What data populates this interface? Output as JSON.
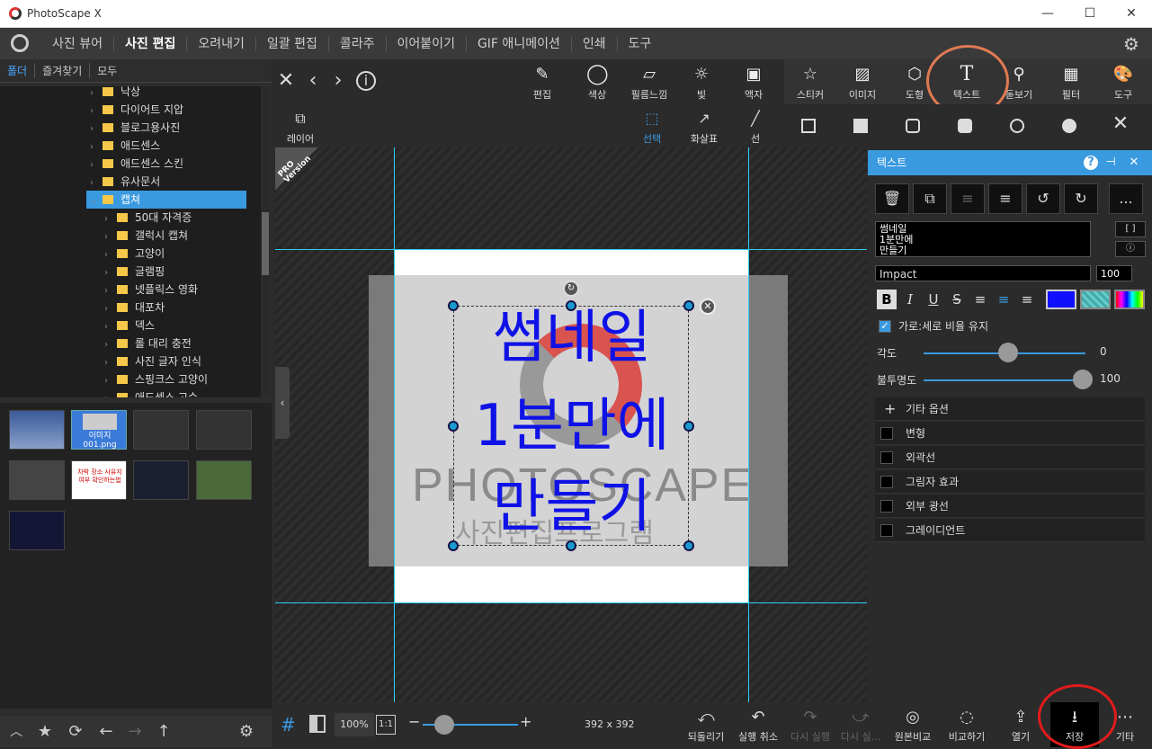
{
  "app": {
    "title": "PhotoScape X",
    "window_controls": [
      "—",
      "☐",
      "✕"
    ]
  },
  "menu": {
    "items": [
      "사진 뷰어",
      "사진 편집",
      "오려내기",
      "일괄 편집",
      "콜라주",
      "이어붙이기",
      "GIF 애니메이션",
      "인쇄",
      "도구"
    ],
    "active": "사진 편집"
  },
  "left_panel": {
    "tabs": [
      "폴더",
      "즐겨찾기",
      "모두"
    ],
    "tree": [
      {
        "label": "낙상",
        "level": 1
      },
      {
        "label": "다이어트 지압",
        "level": 1
      },
      {
        "label": "블로그용사진",
        "level": 1
      },
      {
        "label": "애드센스",
        "level": 1
      },
      {
        "label": "애드센스 스킨",
        "level": 1
      },
      {
        "label": "유사문서",
        "level": 1
      },
      {
        "label": "캡쳐",
        "level": 1,
        "selected": true
      },
      {
        "label": "50대 자격증",
        "level": 2
      },
      {
        "label": "갤럭시 캡쳐",
        "level": 2
      },
      {
        "label": "고양이",
        "level": 2
      },
      {
        "label": "글램핑",
        "level": 2
      },
      {
        "label": "넷플릭스 영화",
        "level": 2
      },
      {
        "label": "대포차",
        "level": 2
      },
      {
        "label": "덱스",
        "level": 2
      },
      {
        "label": "롤 대리 충전",
        "level": 2
      },
      {
        "label": "사진 글자 인식",
        "level": 2
      },
      {
        "label": "스핑크스 고양이",
        "level": 2
      },
      {
        "label": "애드센스 고수",
        "level": 2
      }
    ],
    "thumbnail_selected": {
      "size": "392x392",
      "name": "이미지 001.png"
    },
    "thumbnail_text": "차박 장소 사유지 여부 확인하는법"
  },
  "toolbar": {
    "tools": [
      {
        "label": "편집",
        "icon": "edit-icon"
      },
      {
        "label": "색상",
        "icon": "color-icon"
      },
      {
        "label": "필름느낌",
        "icon": "film-icon"
      },
      {
        "label": "빛",
        "icon": "light-icon"
      },
      {
        "label": "액자",
        "icon": "frame-icon"
      },
      {
        "label": "스티커",
        "icon": "sticker-icon"
      },
      {
        "label": "이미지",
        "icon": "image-icon"
      },
      {
        "label": "도형",
        "icon": "shape-icon"
      },
      {
        "label": "텍스트",
        "icon": "text-icon"
      },
      {
        "label": "돋보기",
        "icon": "magnifier-icon"
      },
      {
        "label": "필터",
        "icon": "filter-icon"
      },
      {
        "label": "도구",
        "icon": "tools-icon"
      }
    ]
  },
  "subbar": {
    "layer": "레이어",
    "select": "선택",
    "arrow": "화살표",
    "line": "선"
  },
  "canvas": {
    "lines": [
      "썸네일",
      "1분만에",
      "만들기"
    ],
    "watermark": "PHOTOSCAPE",
    "watermark_sub": "사진편집프로그램",
    "pro_badge": "PRO Version"
  },
  "text_panel": {
    "title": "텍스트",
    "text_value": "썸네일\n1분만에\n만들기",
    "font": "Impact",
    "font_size": "100",
    "keep_ratio_label": "가로:세로 비율 유지",
    "angle_label": "각도",
    "angle_value": "0",
    "opacity_label": "불투명도",
    "opacity_value": "100",
    "more_options": "기타 옵션",
    "options": [
      "변형",
      "외곽선",
      "그림자 효과",
      "외부 광선",
      "그레이디언트"
    ],
    "bracket_btn": "[ ]",
    "ellipsis_btn": "...",
    "colors": {
      "fill": "#1010ff",
      "accent": "#3a9ae0"
    }
  },
  "bottom": {
    "zoom": "100%",
    "ratio": "1:1",
    "dimensions": "392 x 392",
    "actions": [
      {
        "label": "되돌리기",
        "icon": "revert-icon",
        "disabled": false
      },
      {
        "label": "실행 취소",
        "icon": "undo-icon",
        "disabled": false
      },
      {
        "label": "다시 실행",
        "icon": "redo-icon",
        "disabled": true
      },
      {
        "label": "다시 실...",
        "icon": "redo-all-icon",
        "disabled": true
      },
      {
        "label": "원본비교",
        "icon": "compare-original-icon",
        "disabled": false
      },
      {
        "label": "비교하기",
        "icon": "compare-icon",
        "disabled": false
      },
      {
        "label": "열기",
        "icon": "open-icon",
        "disabled": false
      },
      {
        "label": "저장",
        "icon": "save-icon",
        "disabled": false
      },
      {
        "label": "기타",
        "icon": "more-icon",
        "disabled": false
      }
    ]
  }
}
